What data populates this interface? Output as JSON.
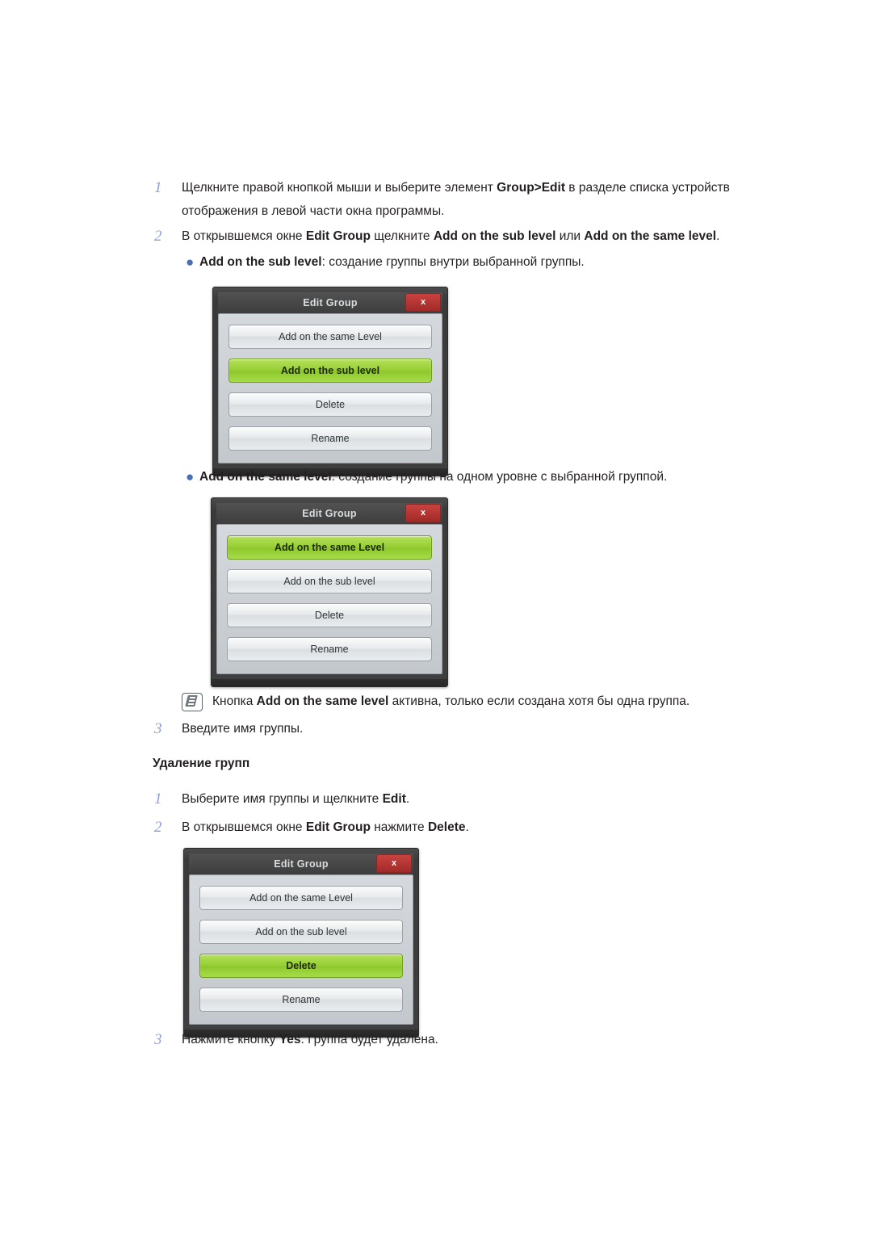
{
  "steps": {
    "step1_num": "1",
    "step1_text_a": "Щелкните правой кнопкой мыши и выберите элемент ",
    "step1_bold_a": "Group>Edit",
    "step1_text_b": " в разделе списка устройств отображения в левой части окна программы.",
    "step2_num": "2",
    "step2_text_a": "В открывшемся окне ",
    "step2_bold_a": "Edit Group",
    "step2_text_b": " щелкните ",
    "step2_bold_b": "Add on the sub level",
    "step2_text_c": " или ",
    "step2_bold_c": "Add on the same level",
    "step2_text_d": ".",
    "step3_num": "3",
    "step3_text": "Введите имя группы."
  },
  "bullets": {
    "dot": "●",
    "b1_bold": "Add on the sub level",
    "b1_text": ": создание группы внутри выбранной группы.",
    "b2_bold": "Add on the same level",
    "b2_text": ": создание группы на одном уровне с выбранной группой."
  },
  "note": {
    "text_a": "Кнопка ",
    "bold": "Add on the same level",
    "text_b": " активна, только если создана хотя бы одна группа."
  },
  "section": {
    "delete_heading": "Удаление групп"
  },
  "delete_steps": {
    "d1_num": "1",
    "d1_text_a": "Выберите имя группы и щелкните ",
    "d1_bold": "Edit",
    "d1_text_b": ".",
    "d2_num": "2",
    "d2_text_a": "В открывшемся окне ",
    "d2_bold_a": "Edit Group",
    "d2_text_b": " нажмите ",
    "d2_bold_b": "Delete",
    "d2_text_c": ".",
    "d3_num": "3",
    "d3_text_a": "Нажмите кнопку ",
    "d3_bold": "Yes",
    "d3_text_b": ". Группа будет удалена."
  },
  "dialogs": {
    "title": "Edit Group",
    "close_label": "x",
    "buttons": {
      "same": "Add on the same Level",
      "sub": "Add on the sub level",
      "delete": "Delete",
      "rename": "Rename"
    },
    "dialog1_active": "sub",
    "dialog2_active": "same",
    "dialog3_active": "delete"
  },
  "colors": {
    "accent_green": "#96ce33",
    "close_red": "#a02b29",
    "step_number": "#8e9ed4",
    "bullet_blue": "#4a6fb5"
  }
}
